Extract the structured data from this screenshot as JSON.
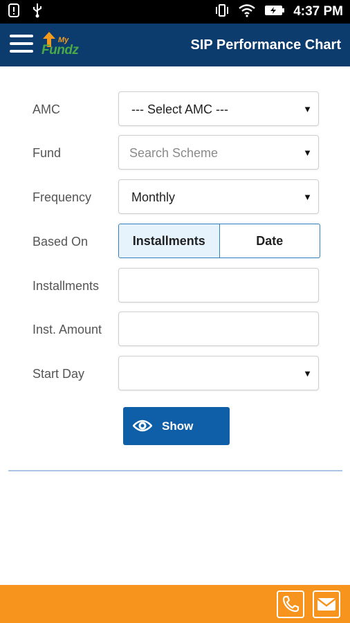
{
  "status_bar": {
    "time": "4:37 PM",
    "icons": [
      "alert-icon",
      "usb-icon",
      "vibrate-icon",
      "wifi-icon",
      "battery-charging-icon"
    ]
  },
  "app_bar": {
    "logo_my": "My",
    "logo_fundz": "Fundz",
    "title": "SIP Performance Chart"
  },
  "form": {
    "amc": {
      "label": "AMC",
      "value": "--- Select AMC ---"
    },
    "fund": {
      "label": "Fund",
      "placeholder": "Search Scheme"
    },
    "frequency": {
      "label": "Frequency",
      "value": "Monthly"
    },
    "based_on": {
      "label": "Based On",
      "options": [
        "Installments",
        "Date"
      ],
      "selected": "Installments"
    },
    "installments": {
      "label": "Installments",
      "value": ""
    },
    "inst_amount": {
      "label": "Inst. Amount",
      "value": ""
    },
    "start_day": {
      "label": "Start Day",
      "value": ""
    }
  },
  "show_button": {
    "label": "Show",
    "icon": "eye-icon"
  },
  "footer": {
    "icons": [
      "phone-icon",
      "mail-icon"
    ]
  },
  "colors": {
    "app_bar": "#0c3c6d",
    "button": "#0e5fa8",
    "footer": "#f7941d",
    "segment_border": "#2f7fc1"
  }
}
